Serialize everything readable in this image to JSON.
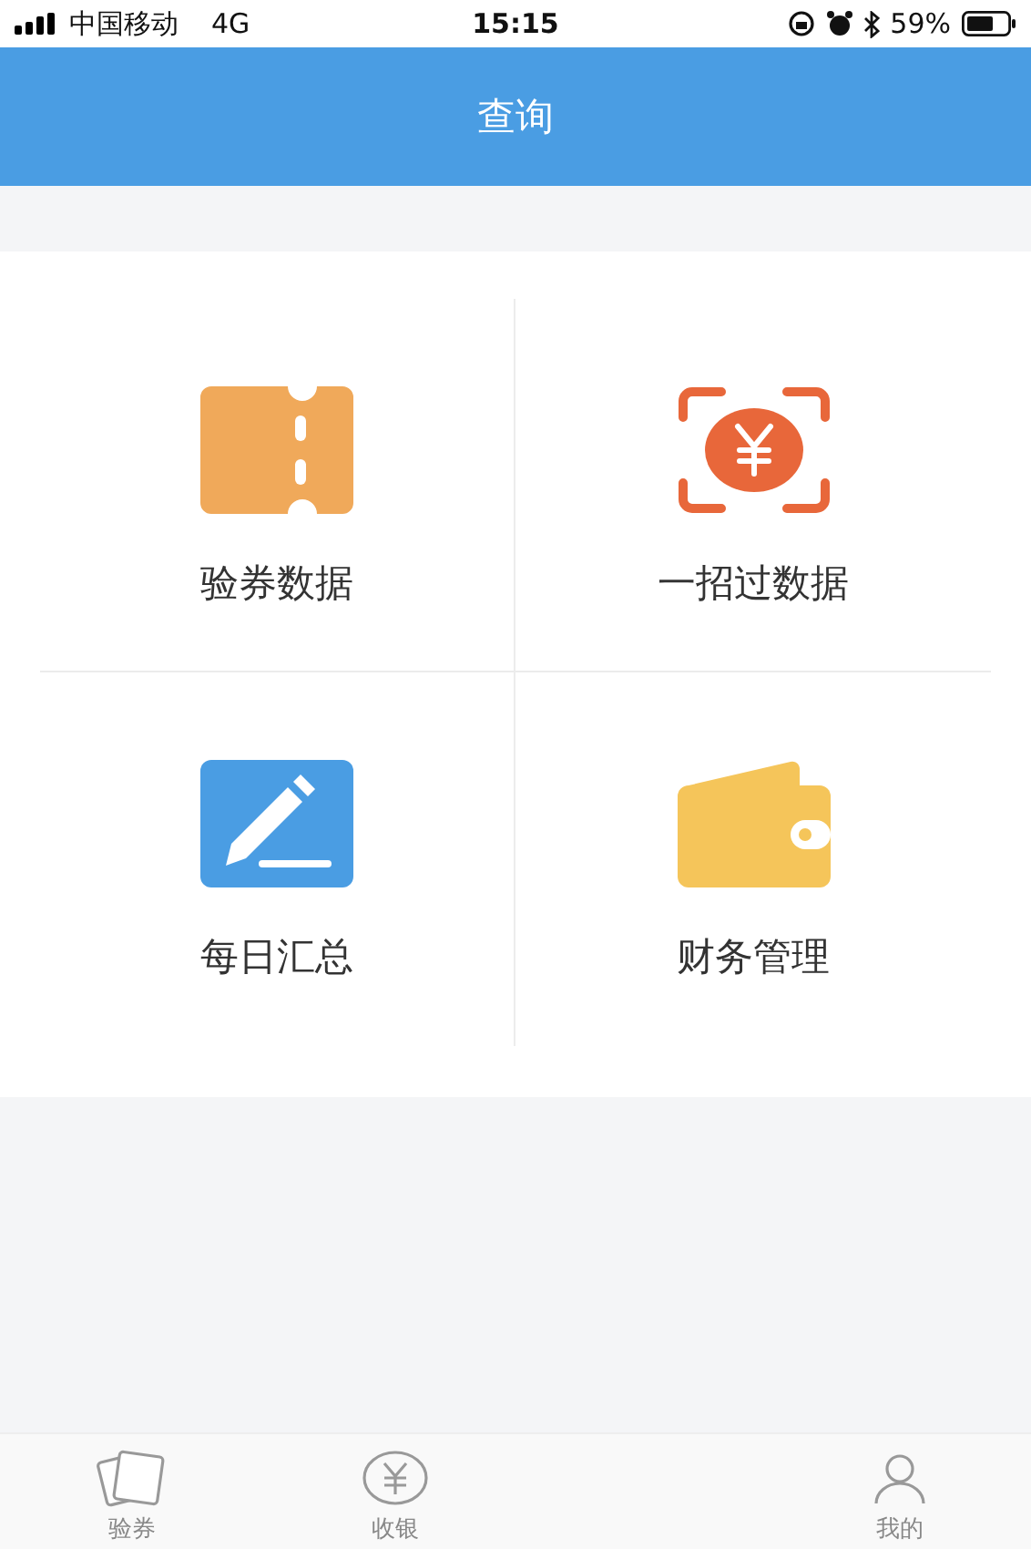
{
  "status_bar": {
    "carrier": "中国移动",
    "network": "4G",
    "time": "15:15",
    "battery": "59%"
  },
  "header": {
    "title": "查询"
  },
  "grid": [
    {
      "label": "验券数据"
    },
    {
      "label": "一招过数据"
    },
    {
      "label": "每日汇总"
    },
    {
      "label": "财务管理"
    }
  ],
  "tab_bar": [
    {
      "label": "验券"
    },
    {
      "label": "收银"
    },
    {
      "label": "我的"
    }
  ]
}
